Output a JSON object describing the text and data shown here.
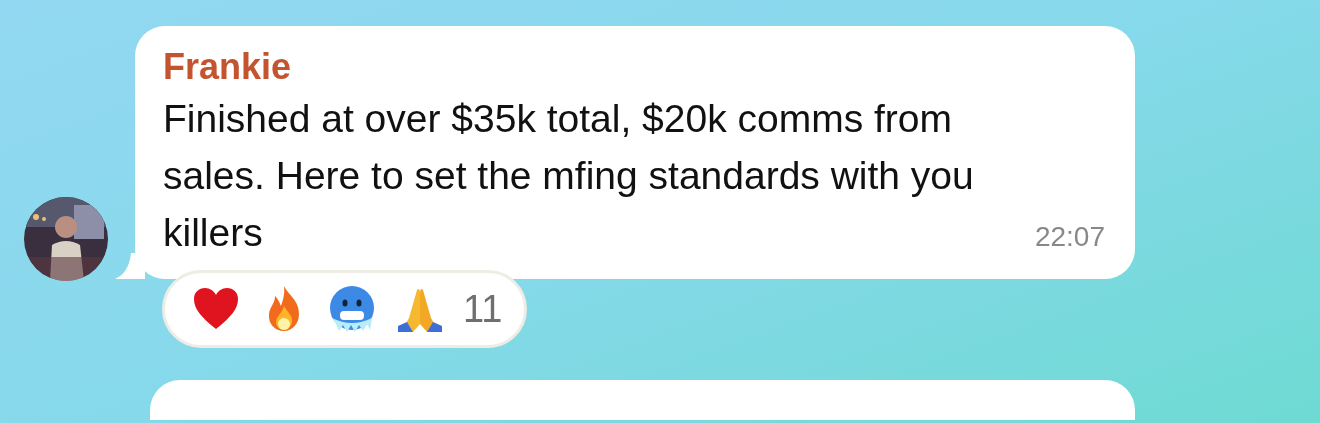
{
  "message": {
    "sender": "Frankie",
    "text": "Finished at over $35k total, $20k comms from sales. Here to set the mfing standards with you killers",
    "time": "22:07"
  },
  "reactions": {
    "items": [
      {
        "kind": "heart"
      },
      {
        "kind": "fire"
      },
      {
        "kind": "cold-face"
      },
      {
        "kind": "pray"
      }
    ],
    "count": "11"
  },
  "next_message": {
    "kind": "bubble"
  }
}
